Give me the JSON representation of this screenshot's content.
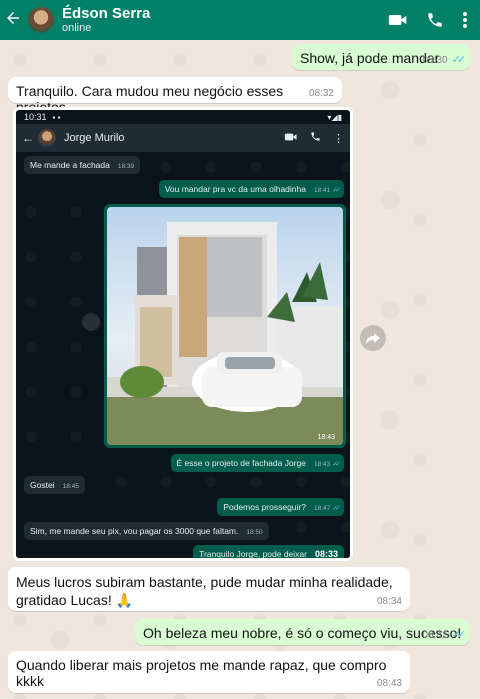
{
  "header": {
    "contact_name": "Édson Serra",
    "status": "online",
    "icons": [
      "back-arrow-icon",
      "video-call-icon",
      "voice-call-icon",
      "more-options-icon"
    ],
    "color": "#008069"
  },
  "messages": [
    {
      "dir": "out",
      "text": "Show, já pode mandar",
      "time": "08:30",
      "read": true
    },
    {
      "dir": "in",
      "text": "Tranquilo. Cara mudou meu negócio esses projetos",
      "time": "08:32"
    },
    {
      "dir": "in",
      "text": "Meus lucros subiram bastante, pude mudar minha realidade, gratidao Lucas! 🙏",
      "time": "08:34"
    },
    {
      "dir": "out",
      "text": "Oh beleza meu nobre, é só o começo viu, sucesso!",
      "time": "08:41",
      "read": true
    },
    {
      "dir": "in",
      "text": "Quando liberar mais projetos me mande rapaz, que compro kkkk",
      "time": "08:43"
    }
  ],
  "screenshot": {
    "status_time": "10:31",
    "contact_name": "Jorge Murilo",
    "messages": [
      {
        "dir": "in",
        "text": "Me mande a fachada",
        "time": "18:39"
      },
      {
        "dir": "out",
        "text": "Vou mandar pra vc da uma olhadinha",
        "time": "18:41"
      },
      {
        "dir": "out",
        "text": "",
        "time": "18:43",
        "image": true
      },
      {
        "dir": "out",
        "text": "É esse o projeto de fachada Jorge",
        "time": "18:43"
      },
      {
        "dir": "in",
        "text": "Gostei",
        "time": "18:45"
      },
      {
        "dir": "out",
        "text": "Podemos prosseguir?",
        "time": "18:47"
      },
      {
        "dir": "in",
        "text": "Sim, me mande seu pix, vou pagar os 3000 que faltam.",
        "time": "18:50"
      },
      {
        "dir": "out",
        "text": "Tranquilo Jorge, pode deixar",
        "time": "08:33"
      }
    ]
  },
  "colors": {
    "incoming": "#ffffff",
    "outgoing": "#d9fdd3",
    "read_tick": "#53bdeb",
    "dark_incoming": "#202c33",
    "dark_outgoing": "#005c4b"
  }
}
